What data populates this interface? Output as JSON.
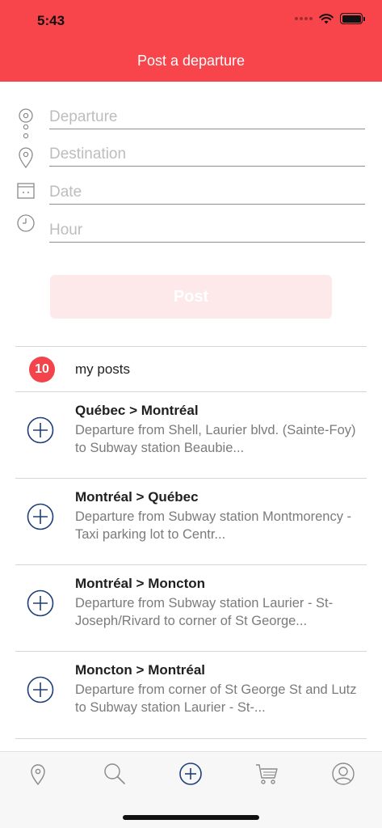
{
  "status_bar": {
    "time": "5:43"
  },
  "header": {
    "title": "Post a departure",
    "color": "#f8444b"
  },
  "form": {
    "fields": [
      {
        "name": "departure",
        "placeholder": "Departure",
        "icon": "origin-icon"
      },
      {
        "name": "destination",
        "placeholder": "Destination",
        "icon": "location-pin-icon"
      },
      {
        "name": "date",
        "placeholder": "Date",
        "icon": "calendar-icon"
      },
      {
        "name": "hour",
        "placeholder": "Hour",
        "icon": "clock-icon"
      }
    ],
    "post_label": "Post",
    "post_enabled": false
  },
  "posts": {
    "count": "10",
    "label": "my posts",
    "items": [
      {
        "title": "Québec > Montréal",
        "description": "Departure from Shell, Laurier blvd. (Sainte-Foy) to Subway station Beaubie..."
      },
      {
        "title": "Montréal > Québec",
        "description": "Departure from Subway station Montmorency - Taxi parking lot to Centr..."
      },
      {
        "title": "Montréal > Moncton",
        "description": "Departure from Subway station Laurier - St-Joseph/Rivard to corner of St George..."
      },
      {
        "title": "Moncton > Montréal",
        "description": "Departure from corner of St George St and Lutz to Subway station Laurier - St-..."
      }
    ]
  },
  "tab_bar": {
    "tabs": [
      {
        "name": "map",
        "icon": "location-pin-icon"
      },
      {
        "name": "search",
        "icon": "search-icon"
      },
      {
        "name": "post",
        "icon": "plus-circle-icon",
        "active": true
      },
      {
        "name": "cart",
        "icon": "cart-icon"
      },
      {
        "name": "profile",
        "icon": "user-icon"
      }
    ],
    "active_color": "#1f3f7a",
    "inactive_color": "#8a8a8a"
  }
}
